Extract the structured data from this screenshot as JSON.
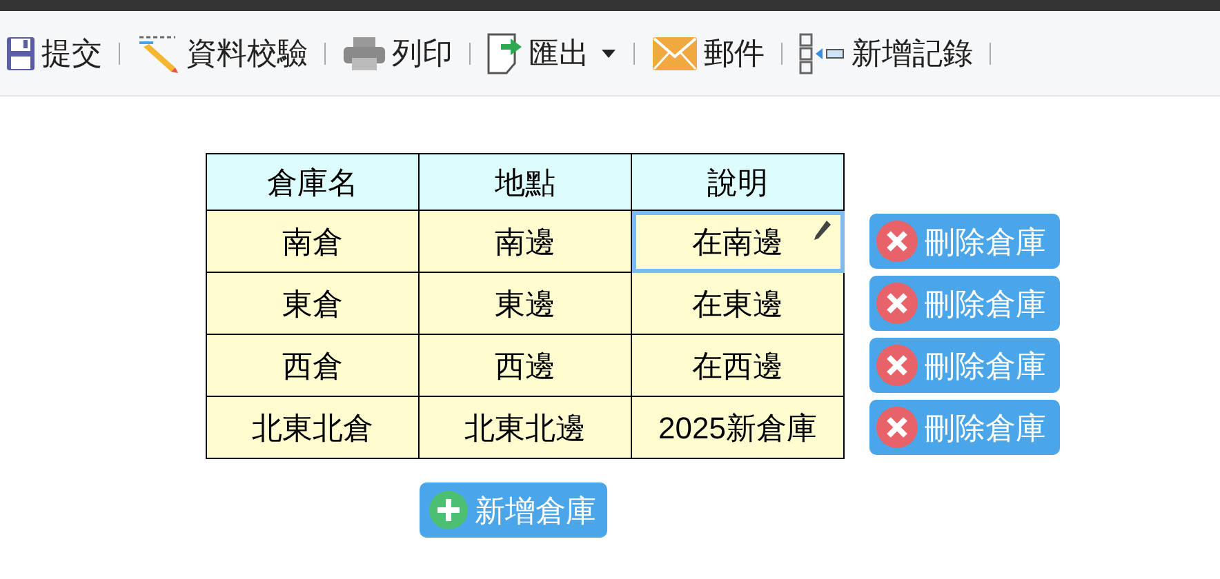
{
  "toolbar": [
    {
      "kind": "save",
      "label": "提交"
    },
    {
      "kind": "validate",
      "label": "資料校驗"
    },
    {
      "kind": "print",
      "label": "列印"
    },
    {
      "kind": "export",
      "label": "匯出",
      "dropdown": true
    },
    {
      "kind": "mail",
      "label": "郵件"
    },
    {
      "kind": "add-record",
      "label": "新增記錄"
    }
  ],
  "table": {
    "columns": [
      "倉庫名",
      "地點",
      "說明"
    ],
    "rows": [
      {
        "cells": [
          {
            "text": "南倉",
            "selected": false
          },
          {
            "text": "南邊",
            "selected": false
          },
          {
            "text": "在南邊",
            "selected": true
          }
        ],
        "delete_button": "刪除倉庫"
      },
      {
        "cells": [
          {
            "text": "東倉",
            "selected": false
          },
          {
            "text": "東邊",
            "selected": false
          },
          {
            "text": "在東邊",
            "selected": false
          }
        ],
        "delete_button": "刪除倉庫"
      },
      {
        "cells": [
          {
            "text": "西倉",
            "selected": false
          },
          {
            "text": "西邊",
            "selected": false
          },
          {
            "text": "在西邊",
            "selected": false
          }
        ],
        "delete_button": "刪除倉庫"
      },
      {
        "cells": [
          {
            "text": "北東北倉",
            "selected": false
          },
          {
            "text": "北東北邊",
            "selected": false
          },
          {
            "text": "2025新倉庫",
            "selected": false
          }
        ],
        "delete_button": "刪除倉庫"
      }
    ]
  },
  "add_button": "新增倉庫"
}
